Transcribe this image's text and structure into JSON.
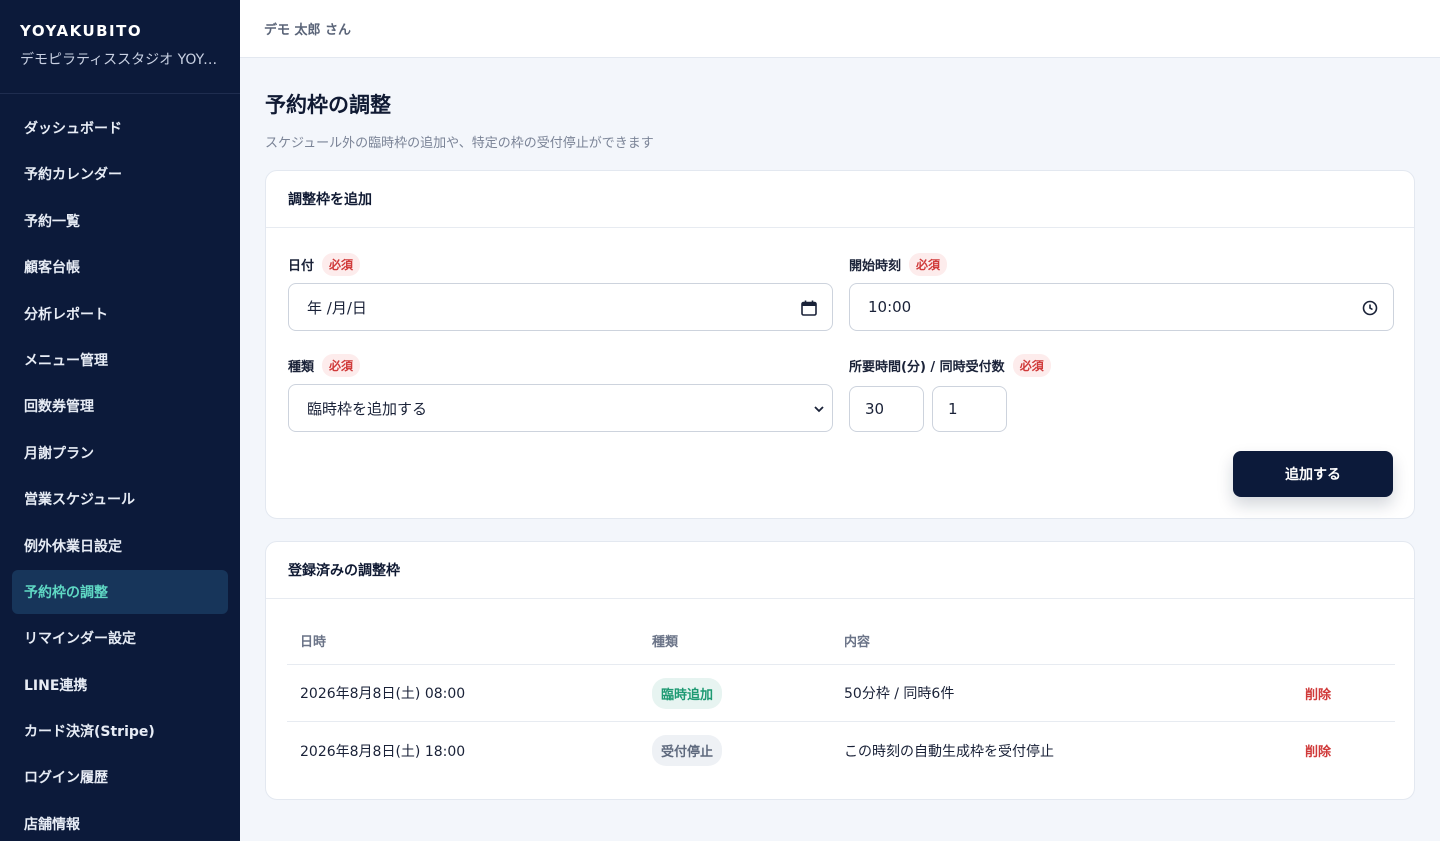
{
  "sidebar": {
    "brand_title": "YOYAKUBITO",
    "brand_sub": "デモピラティススタジオ YOYAKUBITO",
    "items": [
      {
        "label": "ダッシュボード"
      },
      {
        "label": "予約カレンダー"
      },
      {
        "label": "予約一覧"
      },
      {
        "label": "顧客台帳"
      },
      {
        "label": "分析レポート"
      },
      {
        "label": "メニュー管理"
      },
      {
        "label": "回数券管理"
      },
      {
        "label": "月謝プラン"
      },
      {
        "label": "営業スケジュール"
      },
      {
        "label": "例外休業日設定"
      },
      {
        "label": "予約枠の調整",
        "active": true
      },
      {
        "label": "リマインダー設定"
      },
      {
        "label": "LINE連携"
      },
      {
        "label": "カード決済(Stripe)"
      },
      {
        "label": "ログイン履歴"
      },
      {
        "label": "店舗情報"
      }
    ]
  },
  "topbar": {
    "user": "デモ 太郎 さん"
  },
  "page": {
    "title": "予約枠の調整",
    "description": "スケジュール外の臨時枠の追加や、特定の枠の受付停止ができます"
  },
  "add_form": {
    "heading": "調整枠を追加",
    "required": "必須",
    "date_label": "日付",
    "date_value": "年 /月/日",
    "start_label": "開始時刻",
    "start_value": "10:00",
    "type_label": "種類",
    "type_value": "臨時枠を追加する",
    "duration_label": "所要時間(分) / 同時受付数",
    "duration_value": "30",
    "capacity_value": "1",
    "submit_label": "追加する"
  },
  "registered": {
    "heading": "登録済みの調整枠",
    "columns": [
      "日時",
      "種類",
      "内容"
    ],
    "rows": [
      {
        "datetime": "2026年8月8日(土) 08:00",
        "type": "臨時追加",
        "type_kind": "add",
        "content": "50分枠 / 同時6件",
        "action": "削除"
      },
      {
        "datetime": "2026年8月8日(土) 18:00",
        "type": "受付停止",
        "type_kind": "stop",
        "content": "この時刻の自動生成枠を受付停止",
        "action": "削除"
      }
    ]
  },
  "colors": {
    "sidebar_bg": "#0c1a3a",
    "accent": "#5fd8c4",
    "danger": "#d03a3a",
    "badge_add": "#1e9a73"
  }
}
